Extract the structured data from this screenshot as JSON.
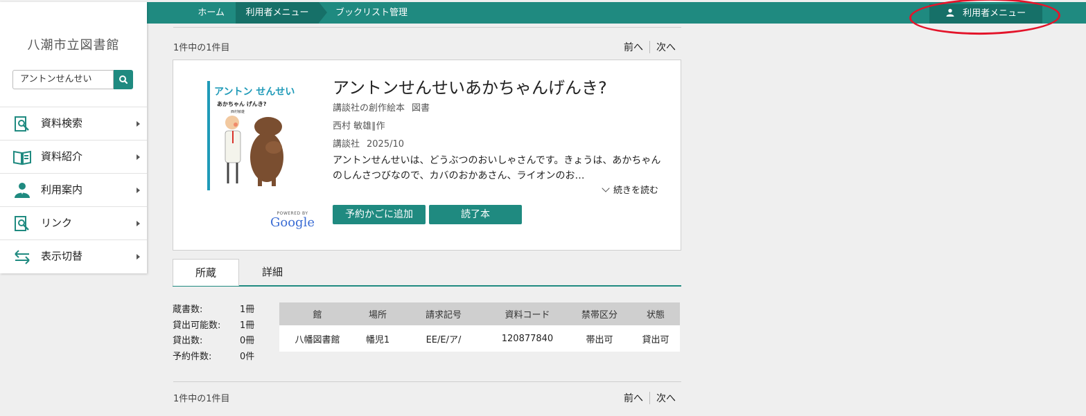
{
  "topbar": {
    "breadcrumbs": [
      "ホーム",
      "利用者メニュー",
      "ブックリスト管理"
    ],
    "user_menu_label": "利用者メニュー"
  },
  "sidebar": {
    "library_name": "八潮市立図書館",
    "search_value": "アントンせんせい",
    "items": [
      {
        "label": "資料検索",
        "icon": "book-search-icon"
      },
      {
        "label": "資料紹介",
        "icon": "open-book-icon"
      },
      {
        "label": "利用案内",
        "icon": "person-icon"
      },
      {
        "label": "リンク",
        "icon": "book-search-icon"
      },
      {
        "label": "表示切替",
        "icon": "switch-arrows-icon"
      }
    ]
  },
  "results": {
    "count_text": "1件中の1件目",
    "prev_label": "前へ",
    "next_label": "次へ"
  },
  "book": {
    "title": "アントンせんせいあかちゃんげんき?",
    "series": "講談社の創作絵本",
    "material_type": "図書",
    "author": "西村 敏雄∥作",
    "publisher": "講談社",
    "date": "2025/10",
    "description": "アントンせんせいは、どうぶつのおいしゃさんです。きょうは、あかちゃんのしんさつびなので、カバのおかあさん、ライオンのお…",
    "read_more_label": "続きを読む",
    "powered_by": "POWERED BY",
    "google": "Google",
    "cover": {
      "title_line1": "アントン せんせい",
      "title_line2": "あかちゃん げんき?",
      "author_small": "西村敏雄"
    },
    "buttons": {
      "reserve": "予約かごに追加",
      "read": "読了本"
    }
  },
  "tabs": [
    "所蔵",
    "詳細"
  ],
  "stats": [
    {
      "label": "蔵書数:",
      "value": "1冊"
    },
    {
      "label": "貸出可能数:",
      "value": "1冊"
    },
    {
      "label": "貸出数:",
      "value": "0冊"
    },
    {
      "label": "予約件数:",
      "value": "0件"
    }
  ],
  "holdings": {
    "headers": [
      "館",
      "場所",
      "請求記号",
      "資料コード",
      "禁帯区分",
      "状態"
    ],
    "rows": [
      [
        "八幡図書館",
        "幡児1",
        "EE/E/ア/",
        "120877840",
        "帯出可",
        "貸出可"
      ]
    ]
  },
  "colors": {
    "accent": "#1f8a80",
    "accent_dark": "#167068",
    "highlight_circle": "#e3142a"
  }
}
